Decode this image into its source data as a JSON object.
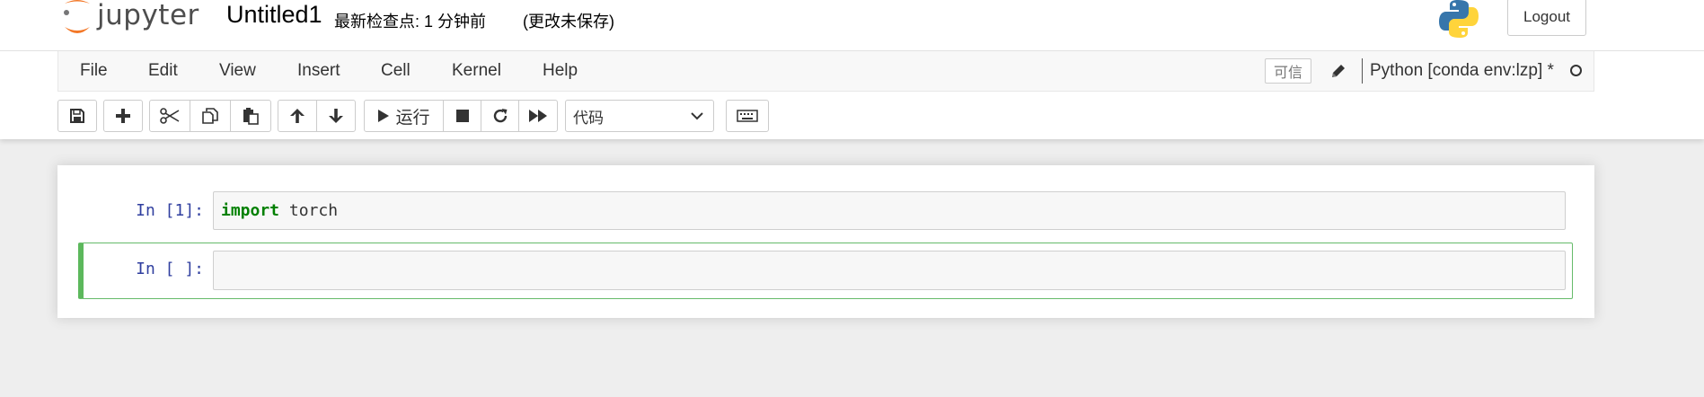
{
  "header": {
    "logo_text": "jupyter",
    "notebook_title": "Untitled1",
    "checkpoint": "最新检查点: 1 分钟前",
    "autosave_status": "(更改未保存)",
    "logout_label": "Logout"
  },
  "menubar": {
    "items": [
      "File",
      "Edit",
      "View",
      "Insert",
      "Cell",
      "Kernel",
      "Help"
    ],
    "trusted_label": "可信",
    "kernel_name": "Python [conda env:lzp] *"
  },
  "toolbar": {
    "run_label": "运行",
    "cell_type": "代码",
    "buttons": [
      "save-icon",
      "plus-icon",
      "cut-icon",
      "copy-icon",
      "paste-icon",
      "arrow-up-icon",
      "arrow-down-icon",
      "play-icon",
      "stop-icon",
      "restart-icon",
      "fast-forward-icon",
      "keyboard-icon"
    ]
  },
  "cells": [
    {
      "prompt": "In  [1]:",
      "code_keyword": "import",
      "code_rest": " torch"
    },
    {
      "prompt": "In  [ ]:",
      "code_keyword": "",
      "code_rest": ""
    }
  ],
  "colors": {
    "prompt": "#303f9f",
    "keyword": "#008000",
    "selected_cell_border": "#66bb6a",
    "jupyter_orange": "#F37726"
  }
}
